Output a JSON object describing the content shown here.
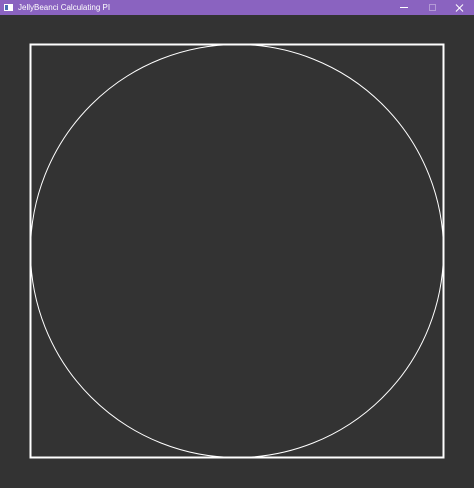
{
  "window": {
    "title": "JellyBeanci Calculating PI",
    "titlebar_color": "#8a63c0",
    "background_color": "#333333"
  },
  "controls": {
    "minimize_icon": "minimize-icon",
    "maximize_icon": "maximize-icon",
    "close_icon": "close-icon"
  },
  "canvas": {
    "stroke_color": "#ffffff",
    "shapes": [
      "square",
      "inscribed-circle"
    ]
  }
}
